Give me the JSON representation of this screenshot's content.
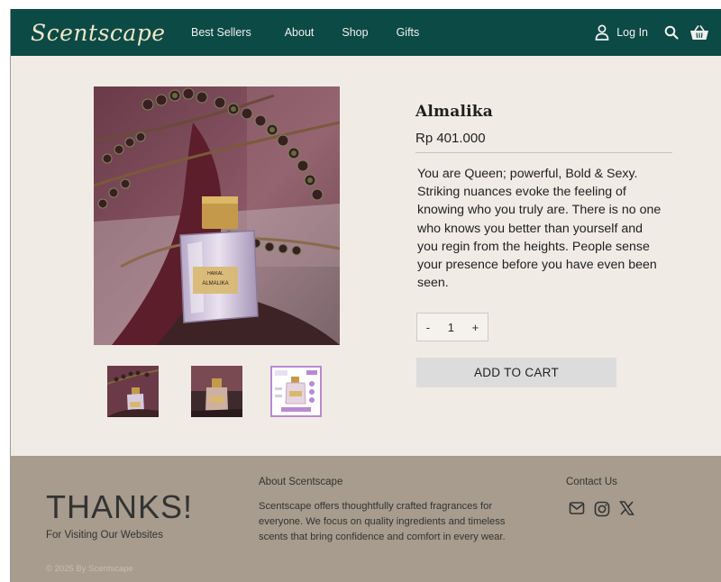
{
  "nav": {
    "logo": "Scentscape",
    "links": [
      "Best Sellers",
      "About",
      "Shop",
      "Gifts"
    ],
    "login": "Log In",
    "icons": [
      "user-icon",
      "search-icon",
      "basket-icon"
    ]
  },
  "product": {
    "name": "Almalika",
    "price": "Rp 401.000",
    "description": "You are Queen; powerful, Bold & Sexy. Striking nuances evoke the feeling of knowing who you truly are. There is no one who knows you better than yourself and you regin from the heights. People sense your presence before you have even been seen.",
    "quantity": "1",
    "minus": "-",
    "plus": "+",
    "add_to_cart": "ADD TO CART",
    "bottle_brand": "HAIKAL",
    "bottle_label": "ALMALIKA"
  },
  "footer": {
    "thanks": "THANKS!",
    "visiting": "For Visiting Our Websites",
    "copyright": "© 2025 By Scentscape",
    "about_heading": "About Scentscape",
    "about_text": "Scentscape offers thoughtfully crafted fragrances for everyone. We focus on quality ingredients and timeless scents that bring confidence and comfort in every wear.",
    "contact_heading": "Contact Us",
    "social_icons": [
      "mail-icon",
      "instagram-icon",
      "x-icon"
    ]
  },
  "colors": {
    "nav_bg": "#0c4a45",
    "main_bg": "#f0ebe5",
    "footer_bg": "#a79c8d",
    "cart_button": "#dcdcdc",
    "logo": "#efe6c8"
  }
}
